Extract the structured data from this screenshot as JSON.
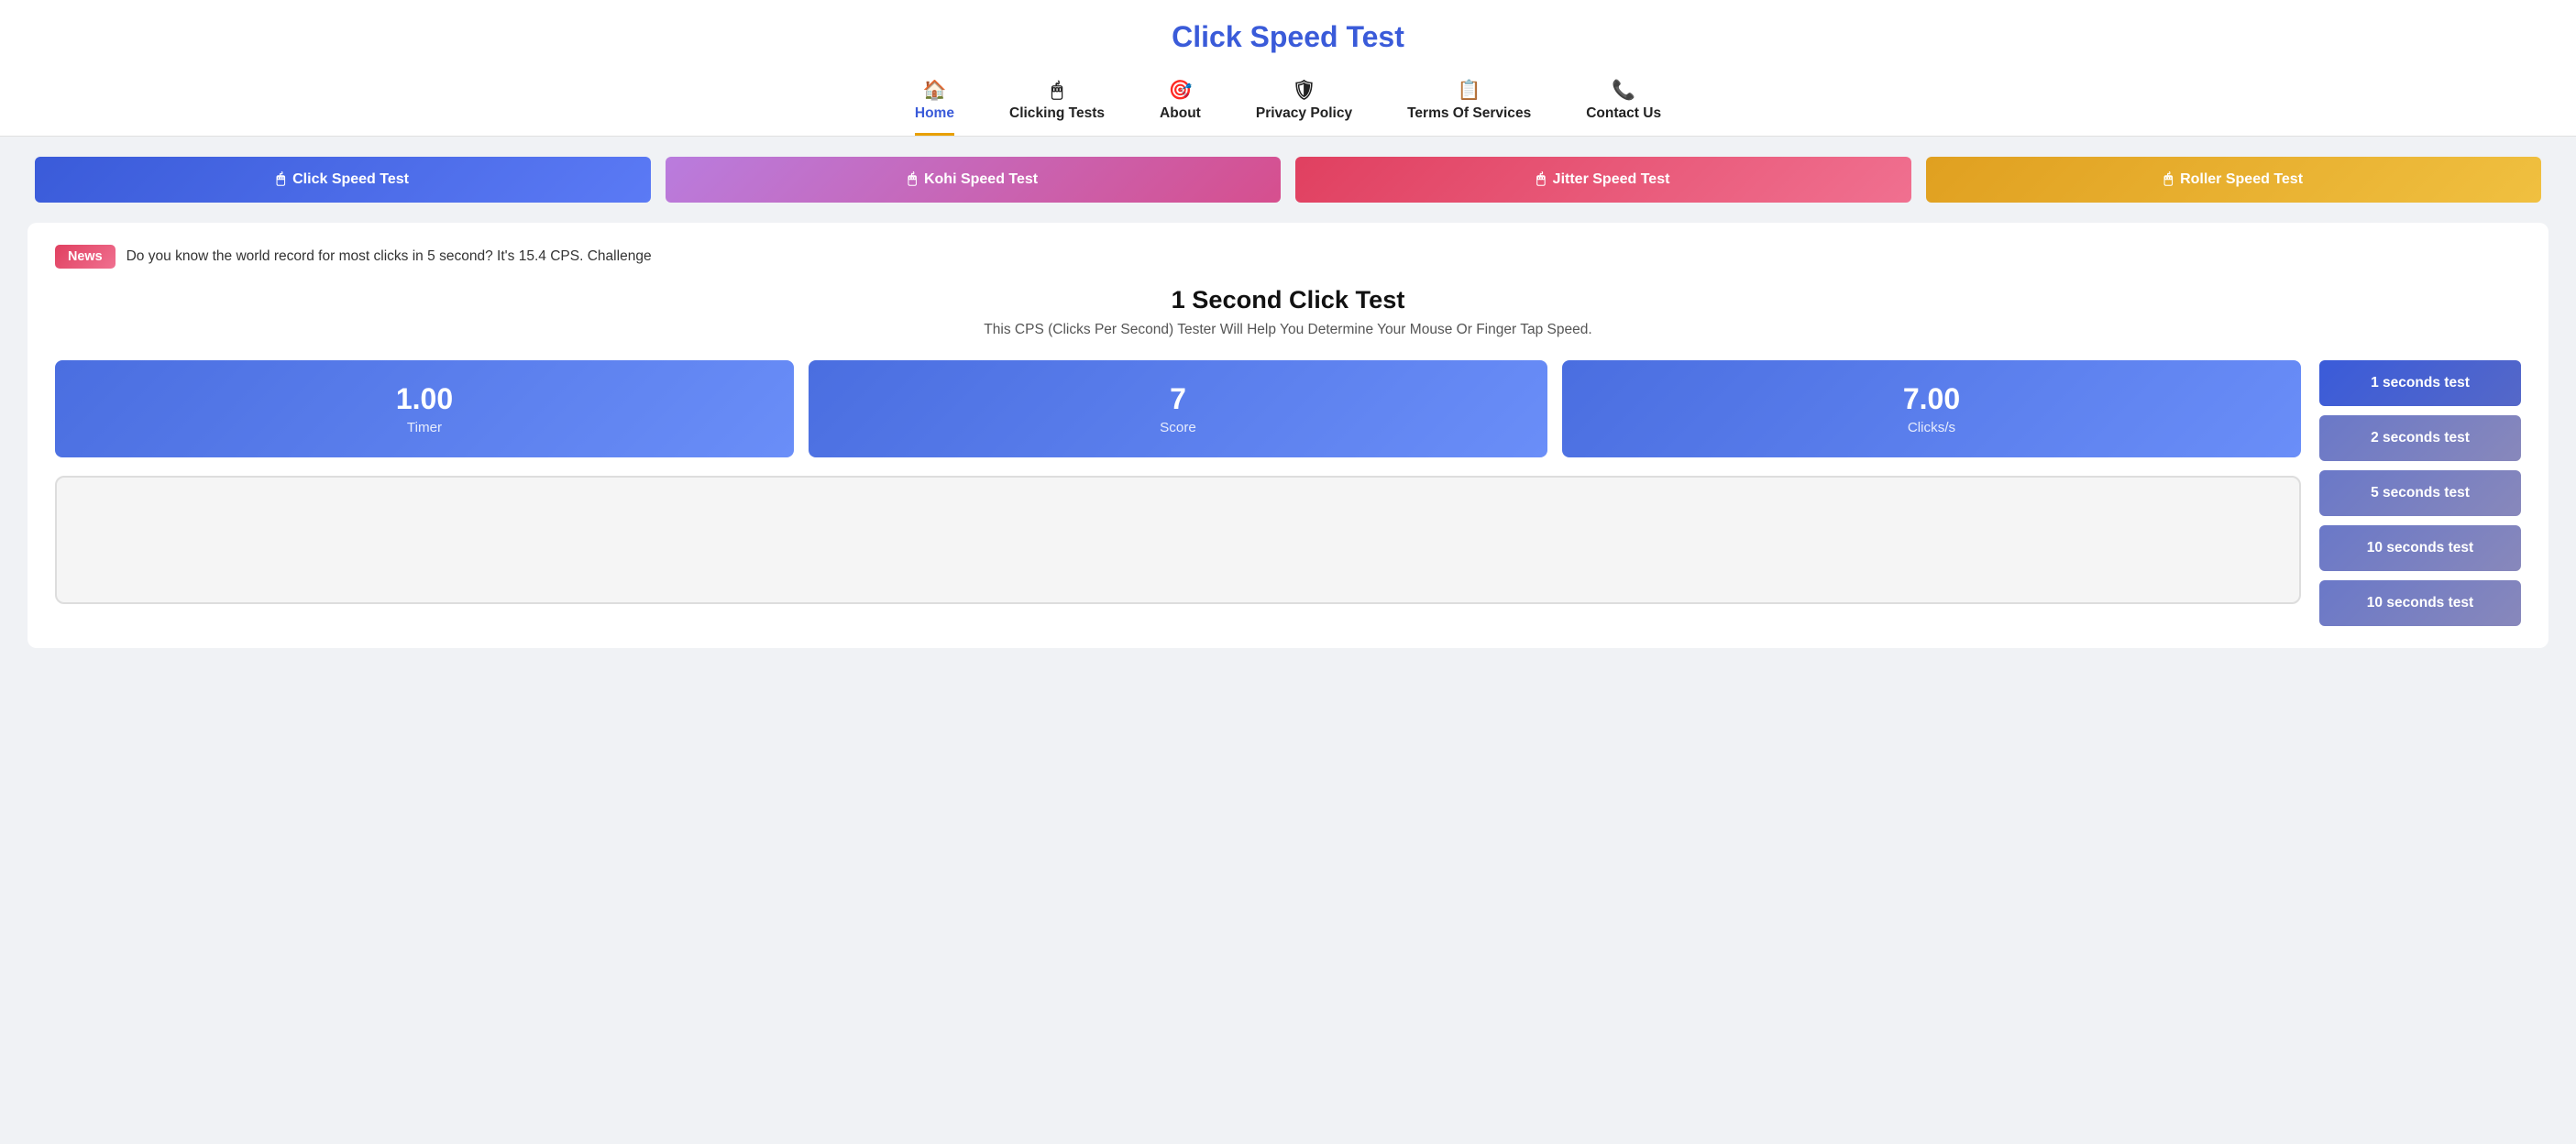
{
  "header": {
    "site_title": "Click Speed Test",
    "nav": [
      {
        "id": "home",
        "label": "Home",
        "icon": "🏠",
        "active": true
      },
      {
        "id": "clicking-tests",
        "label": "Clicking Tests",
        "icon": "🖱",
        "active": false
      },
      {
        "id": "about",
        "label": "About",
        "icon": "🎯",
        "active": false
      },
      {
        "id": "privacy-policy",
        "label": "Privacy Policy",
        "icon": "🛡",
        "active": false
      },
      {
        "id": "terms-of-services",
        "label": "Terms Of Services",
        "icon": "📋",
        "active": false
      },
      {
        "id": "contact-us",
        "label": "Contact Us",
        "icon": "📞",
        "active": false
      }
    ]
  },
  "test_buttons": [
    {
      "id": "click-speed",
      "label": "Click Speed Test",
      "class": "click-speed"
    },
    {
      "id": "kohi-speed",
      "label": "Kohi Speed Test",
      "class": "kohi-speed"
    },
    {
      "id": "jitter-speed",
      "label": "Jitter Speed Test",
      "class": "jitter-speed"
    },
    {
      "id": "roller-speed",
      "label": "Roller Speed Test",
      "class": "roller-speed"
    }
  ],
  "news": {
    "badge": "News",
    "text": "Do you know the world record for most clicks in 5 second? It's 15.4 CPS. Challenge"
  },
  "section": {
    "title": "1 Second Click Test",
    "subtitle": "This CPS (Clicks Per Second) Tester Will Help You Determine Your Mouse Or Finger Tap Speed."
  },
  "stats": [
    {
      "value": "1.00",
      "label": "Timer"
    },
    {
      "value": "7",
      "label": "Score"
    },
    {
      "value": "7.00",
      "label": "Clicks/s"
    }
  ],
  "side_buttons": [
    {
      "label": "1 seconds test",
      "muted": false
    },
    {
      "label": "2 seconds test",
      "muted": true
    },
    {
      "label": "5 seconds test",
      "muted": true
    },
    {
      "label": "10 seconds test",
      "muted": true
    },
    {
      "label": "10 seconds test",
      "muted": true
    }
  ],
  "mouse_icon": "🖱"
}
